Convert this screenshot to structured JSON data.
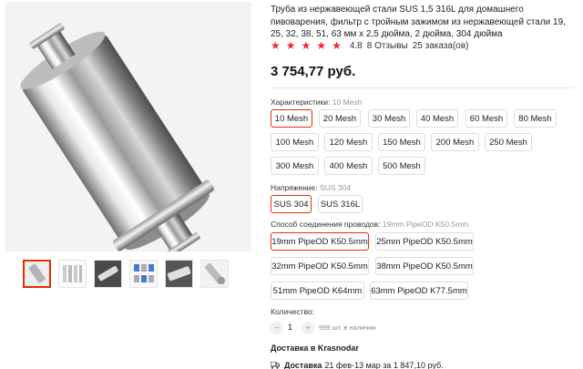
{
  "product": {
    "title": "Труба из нержавеющей стали SUS 1,5 316L для домашнего пивоварения, фильтр с тройным зажимом из нержавеющей стали 19, 25, 32, 38, 51, 63 мм x 2,5 дюйма, 2 дюйма, 304 дюйма",
    "rating": "4.8",
    "rating_fraction": 0.96,
    "reviews": "8 Отзывы",
    "orders": "25 заказа(ов)",
    "price": "3 754,77 руб."
  },
  "gallery": {
    "thumbnails": [
      "thumb-1",
      "thumb-2",
      "thumb-3",
      "thumb-4",
      "thumb-5",
      "thumb-6"
    ],
    "active_index": 0
  },
  "options": {
    "characteristics": {
      "label": "Характеристики:",
      "selected": "10 Mesh",
      "values": [
        "10 Mesh",
        "20 Mesh",
        "30 Mesh",
        "40 Mesh",
        "60 Mesh",
        "80 Mesh",
        "100 Mesh",
        "120 Mesh",
        "150 Mesh",
        "200 Mesh",
        "250 Mesh",
        "300 Mesh",
        "400 Mesh",
        "500 Mesh"
      ]
    },
    "voltage": {
      "label": "Напряжение:",
      "selected": "SUS 304",
      "values": [
        "SUS 304",
        "SUS 316L"
      ]
    },
    "connection": {
      "label": "Способ соединения проводов:",
      "selected": "19mm PipeOD K50.5mm",
      "values": [
        "19mm PipeOD K50.5mm",
        "25mm PipeOD K50.5mm",
        "32mm PipeOD K50.5mm",
        "38mm PipeOD K50.5mm",
        "51mm PipeOD K64mm",
        "63mm PipeOD K77.5mm"
      ]
    }
  },
  "quantity": {
    "label": "Количество:",
    "minus": "−",
    "value": "1",
    "plus": "+",
    "stock": "999 шт. в наличии"
  },
  "delivery": {
    "heading": "Доставка в Krasnodar",
    "label": "Доставка",
    "text": "21 фев-13 мар за 1 847,10 руб."
  },
  "colors": {
    "accent": "#e62e04",
    "star": "#f5243d"
  }
}
